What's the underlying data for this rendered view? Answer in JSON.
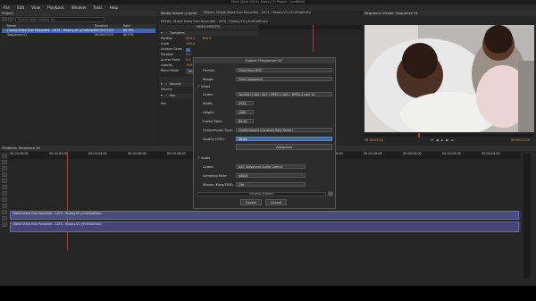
{
  "window": {
    "title": "Olive (April 2019 | Alpha) [*] Project - (untitled)"
  },
  "menu": [
    "File",
    "Edit",
    "View",
    "Playback",
    "Window",
    "Tools",
    "Help"
  ],
  "project": {
    "header": "Project",
    "search_placeholder": "Search media, markers, etc.",
    "columns": [
      "Name",
      "Duration",
      "Rate"
    ],
    "rows": [
      {
        "name": "Oldest Video Ever Recorded - 1874 - History-VC-y7mEOwEmkv",
        "duration": "00:09:17:03",
        "rate": "60 FPS"
      },
      {
        "name": "Sequence 01",
        "duration": "00:09:17:03",
        "rate": "60 FPS"
      }
    ]
  },
  "media_viewer": {
    "header": "Media Viewer: (none)",
    "subtitle": "Effects: Oldest Video Ever Recorded - 1874 - History-VC-y7mEOwEmkv"
  },
  "effects": {
    "header": "Effects: Oldest Video Ever Recorded - 1874 - History-VC-y7mEOwEmkv",
    "video_effects": "VIDEO EFFECTS",
    "transform_label": "Transform",
    "props": [
      {
        "label": "Position",
        "value": "640.0",
        "value2": "360.0"
      },
      {
        "label": "Scale",
        "value": "100.0",
        "value2": ""
      },
      {
        "label": "Uniform Scale",
        "value": "",
        "value2": ""
      },
      {
        "label": "Rotation",
        "value": "0.0",
        "value2": ""
      },
      {
        "label": "Anchor Point",
        "value": "0.0",
        "value2": "0.0"
      },
      {
        "label": "Opacity",
        "value": "100.0",
        "value2": ""
      },
      {
        "label": "Blend Mode",
        "value": "Normal",
        "value2": ""
      }
    ],
    "audio_effects": "AUDIO EFFECTS",
    "volume_label": "Volume",
    "volume_prop": "Volume",
    "pan_label": "Pan",
    "pan_prop": "Pan"
  },
  "sequence_viewer": {
    "header": "Sequence Viewer: Sequence 01",
    "timecode_left": "00:00:03:10",
    "timecode_right": "00:09:17:03"
  },
  "timeline": {
    "header": "Timeline: Sequence 01",
    "timecodes": [
      "00:00:00:00",
      "00:00:02:00",
      "00:00:04:00",
      "00:00:06:00",
      "00:00:08:00",
      "00:00:10:00",
      "00:00:12:00",
      "00:00:14:00",
      "00:00:16:00",
      "00:00:18:00",
      "00:00:20:00",
      "00:00:22:00",
      "00:00:24:00"
    ],
    "video_clip": "Oldest Video Ever Recorded - 1874 - History-VC-y7mEOwEmkv",
    "audio_clip": "Oldest Video Ever Recorded - 1874 - History-VC-y7mEOwEmkv"
  },
  "export_dialog": {
    "title": "Export \"Sequence 01\"",
    "format_label": "Format:",
    "format_value": "QuickTime MOV",
    "range_label": "Range:",
    "range_value": "Entire Sequence",
    "video_section": "Video",
    "codec_label": "Codec:",
    "codec_value": "libx264 H.264 / AVC / MPEG-4 AVC / MPEG-4 part 10",
    "width_label": "Width:",
    "width_value": "1920",
    "height_label": "Height:",
    "height_value": "1080",
    "framerate_label": "Frame Rate:",
    "framerate_value": "60.00",
    "compression_label": "Compression Type:",
    "compression_value": "Quality-based (Constant Rate Factor)",
    "quality_label": "Quality (CRF):",
    "quality_value": "36.00",
    "advanced_label": "Advanced",
    "audio_section": "Audio",
    "acodec_label": "Codec:",
    "acodec_value": "AAC (Advanced Audio Coding)",
    "sampling_label": "Sampling Rate:",
    "sampling_value": "48000",
    "bitrate_label": "Bitrate (Kbps/CBR):",
    "bitrate_value": "256",
    "progress_text": "0% (ETA: 0:00:00)",
    "progress": 0,
    "export_label": "Export",
    "cancel_label": "Cancel"
  },
  "colors": {
    "accent": "#3f6aa6",
    "playhead": "#d03030",
    "value": "#e0a340",
    "clip": "#4b4b8a"
  }
}
